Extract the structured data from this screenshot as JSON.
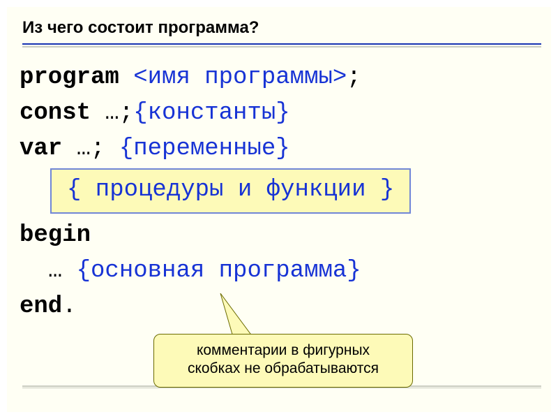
{
  "slide": {
    "title": "Из чего состоит программа?"
  },
  "code": {
    "l1_kw": "program ",
    "l1_ph": "<имя программы>",
    "l1_end": ";",
    "l2_kw": "const ",
    "l2_ell": "…;",
    "l2_cmt": "{константы}",
    "l3_kw": "var ",
    "l3_ell": "…; ",
    "l3_cmt": "{переменные}",
    "l4_box": "{ процедуры и функции }",
    "l5_kw": "begin",
    "l6_indent": "  ",
    "l6_ell": "… ",
    "l6_cmt": "{основная программа}",
    "l7_kw": "end",
    "l7_dot": "."
  },
  "callout": {
    "line1": "комментарии в фигурных",
    "line2": "скобках не обрабатываются"
  }
}
